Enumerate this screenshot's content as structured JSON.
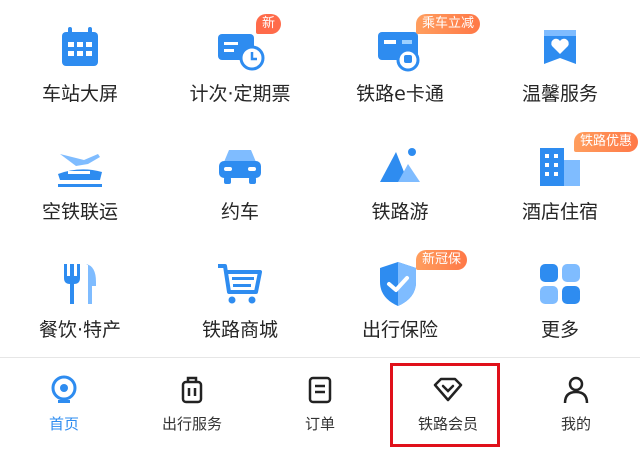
{
  "grid": [
    {
      "label": "车站大屏",
      "icon": "calendar-icon",
      "badge": null
    },
    {
      "label": "计次·定期票",
      "icon": "ticket-clock-icon",
      "badge": "新"
    },
    {
      "label": "铁路e卡通",
      "icon": "card-train-icon",
      "badge": "乘车立减"
    },
    {
      "label": "温馨服务",
      "icon": "heart-box-icon",
      "badge": null
    },
    {
      "label": "空铁联运",
      "icon": "plane-train-icon",
      "badge": null
    },
    {
      "label": "约车",
      "icon": "car-icon",
      "badge": null
    },
    {
      "label": "铁路游",
      "icon": "mountain-icon",
      "badge": null
    },
    {
      "label": "酒店住宿",
      "icon": "hotel-icon",
      "badge": "铁路优惠"
    },
    {
      "label": "餐饮·特产",
      "icon": "fork-knife-icon",
      "badge": null
    },
    {
      "label": "铁路商城",
      "icon": "cart-icon",
      "badge": null
    },
    {
      "label": "出行保险",
      "icon": "shield-icon",
      "badge": "新冠保"
    },
    {
      "label": "更多",
      "icon": "grid-more-icon",
      "badge": null
    }
  ],
  "tabs": [
    {
      "label": "首页",
      "icon": "home-logo-icon",
      "active": true
    },
    {
      "label": "出行服务",
      "icon": "suitcase-icon",
      "active": false
    },
    {
      "label": "订单",
      "icon": "order-list-icon",
      "active": false
    },
    {
      "label": "铁路会员",
      "icon": "diamond-icon",
      "active": false
    },
    {
      "label": "我的",
      "icon": "user-icon",
      "active": false
    }
  ],
  "colors": {
    "primary": "#2e8cf0",
    "badge": "#ff7847",
    "highlight": "#e0101a"
  }
}
